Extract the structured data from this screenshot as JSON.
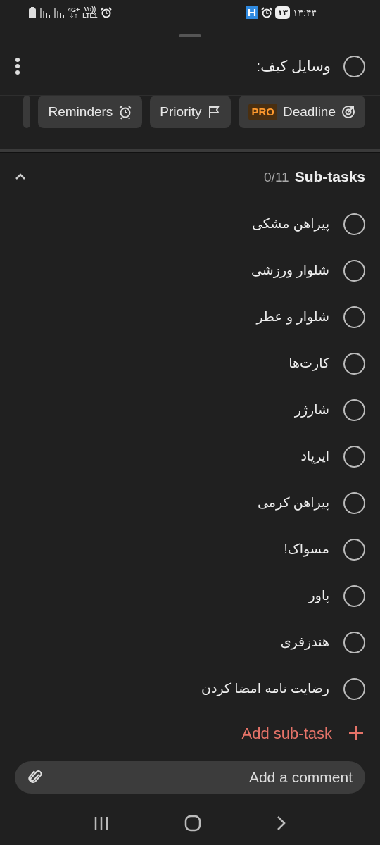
{
  "status_bar": {
    "network": "4G+",
    "volte": "Vo))",
    "lte": "LTE1",
    "date_badge": "۱۳",
    "time": "۱۴:۴۴"
  },
  "task": {
    "title": "وسایل کیف:",
    "checked": false
  },
  "chips": [
    {
      "kind": "pro",
      "badge": "PRO",
      "label": "Deadline"
    },
    {
      "kind": "plain",
      "label": "Priority"
    },
    {
      "kind": "plain",
      "label": "Reminders"
    },
    {
      "kind": "cut"
    }
  ],
  "subtasks": {
    "title": "Sub-tasks",
    "count": "0/11",
    "expanded": true,
    "items": [
      {
        "text": "پیراهن مشکی",
        "checked": false
      },
      {
        "text": "شلوار ورزشی",
        "checked": false
      },
      {
        "text": "شلوار و عطر",
        "checked": false
      },
      {
        "text": "کارت‌ها",
        "checked": false
      },
      {
        "text": "شارژر",
        "checked": false
      },
      {
        "text": "ایرپاد",
        "checked": false
      },
      {
        "text": "پیراهن کرمی",
        "checked": false
      },
      {
        "text": "مسواک!",
        "checked": false
      },
      {
        "text": "پاور",
        "checked": false
      },
      {
        "text": "هندزفری",
        "checked": false
      },
      {
        "text": "رضایت نامه امضا کردن",
        "checked": false
      }
    ],
    "add_label": "Add sub-task"
  },
  "comment": {
    "placeholder": "Add a comment"
  }
}
